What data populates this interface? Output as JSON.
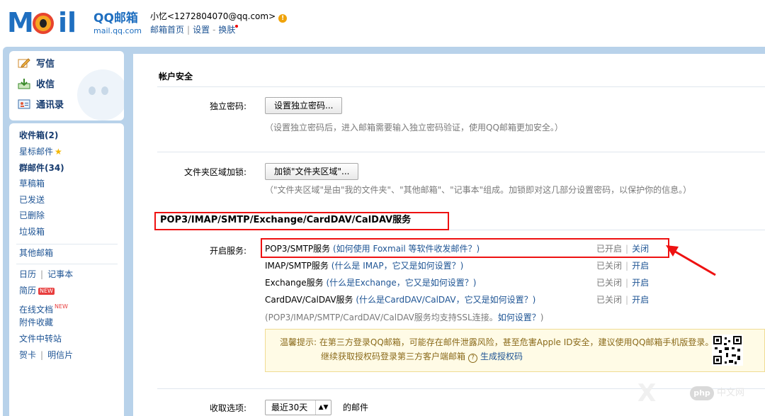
{
  "header": {
    "logo_text_main": "QQ邮箱",
    "logo_text_sub": "mail.qq.com",
    "user": "小忆<1272804070@qq.com>",
    "warn_icon": "!",
    "links": [
      "邮箱首页",
      "设置",
      "换肤"
    ]
  },
  "sidebar": {
    "compose": "写信",
    "inbox_btn": "收信",
    "contacts": "通讯录",
    "folders": [
      {
        "label": "收件箱(2)",
        "bold": true
      },
      {
        "label": "星标邮件",
        "bold": false
      },
      {
        "label": "群邮件(34)",
        "bold": true
      },
      {
        "label": "草稿箱",
        "bold": false
      },
      {
        "label": "已发送",
        "bold": false
      },
      {
        "label": "已删除",
        "bold": false
      },
      {
        "label": "垃圾箱",
        "bold": false
      }
    ],
    "other_mail": "其他邮箱",
    "calendar": "日历",
    "notes": "记事本",
    "resume": "简历",
    "resume_badge": "NEW",
    "docs": "在线文档",
    "docs_badge": "NEW",
    "attachments": "附件收藏",
    "transfer": "文件中转站",
    "cards": "贺卡",
    "postcards": "明信片"
  },
  "account_security": {
    "title": "帐户安全",
    "password_label": "独立密码:",
    "password_button": "设置独立密码...",
    "password_note": "（设置独立密码后，进入邮箱需要输入独立密码验证，使用QQ邮箱更加安全。）",
    "folder_lock_label": "文件夹区域加锁:",
    "folder_lock_button": "加锁\"文件夹区域\"...",
    "folder_lock_note": "（\"文件夹区域\"是由\"我的文件夹\"、\"其他邮箱\"、\"记事本\"组成。加锁即对这几部分设置密码，以保护你的信息。）"
  },
  "services": {
    "title": "POP3/IMAP/SMTP/Exchange/CardDAV/CalDAV服务",
    "label": "开启服务:",
    "items": [
      {
        "name": "POP3/SMTP服务",
        "help": "(如何使用 Foxmail 等软件收发邮件？)",
        "status": "已开启",
        "action": "关闭"
      },
      {
        "name": "IMAP/SMTP服务",
        "help": "(什么是 IMAP，它又是如何设置？)",
        "status": "已关闭",
        "action": "开启"
      },
      {
        "name": "Exchange服务",
        "help": "(什么是Exchange，它又是如何设置？)",
        "status": "已关闭",
        "action": "开启"
      },
      {
        "name": "CardDAV/CalDAV服务",
        "help": "(什么是CardDAV/CalDAV，它又是如何设置？)",
        "status": "已关闭",
        "action": "开启"
      }
    ],
    "ssl_note": "(POP3/IMAP/SMTP/CardDAV/CalDAV服务均支持SSL连接。",
    "ssl_link": "如何设置？",
    "ssl_note_end": ")"
  },
  "tip": {
    "prefix": "温馨提示:",
    "line1": "在第三方登录QQ邮箱，可能存在邮件泄露风险，甚至危害Apple ID安全，建议使用QQ邮箱手机版登录。",
    "line2": "继续获取授权码登录第三方客户端邮箱",
    "help_icon": "?",
    "link": "生成授权码"
  },
  "fetch": {
    "label": "收取选项:",
    "select_value": "最近30天",
    "suffix": "的邮件"
  },
  "watermark": {
    "logo": "php",
    "text": "中文网"
  },
  "colors": {
    "frame": "#b8d2ea",
    "link": "#1e5494",
    "highlight": "#e11111"
  }
}
